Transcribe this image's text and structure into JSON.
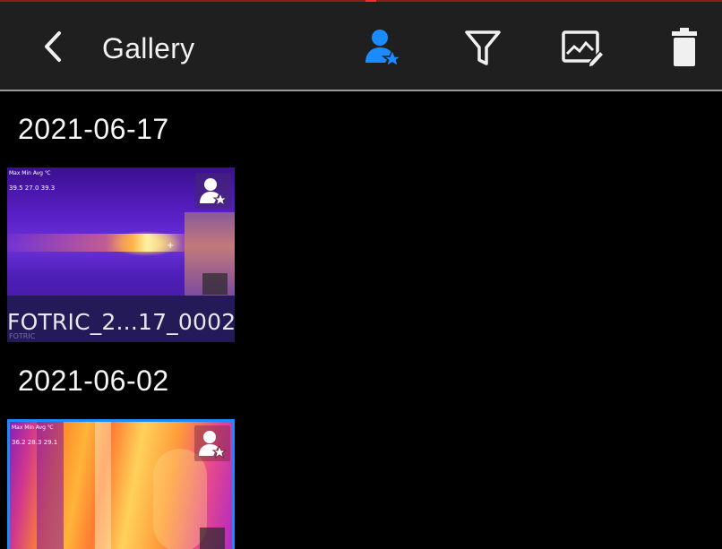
{
  "appbar": {
    "title": "Gallery",
    "back_icon": "chevron-left-icon",
    "user_filter_icon": "user-star-icon",
    "filter_icon": "filter-icon",
    "edit_icon": "image-edit-icon",
    "delete_icon": "trash-icon",
    "accent_color": "#1a8cff"
  },
  "groups": [
    {
      "date": "2021-06-17",
      "items": [
        {
          "filename": "FOTRIC_2...17_0002",
          "readout_labels": "Max  Min  Avg  ℃",
          "readout_values": "39.5 27.0 39.3",
          "watermark": "FOTRIC",
          "selected": false
        }
      ]
    },
    {
      "date": "2021-06-02",
      "items": [
        {
          "readout_labels": "Max  Min  Avg  ℃",
          "readout_values": "36.2 28.3 29.1",
          "selected": true
        }
      ]
    }
  ]
}
